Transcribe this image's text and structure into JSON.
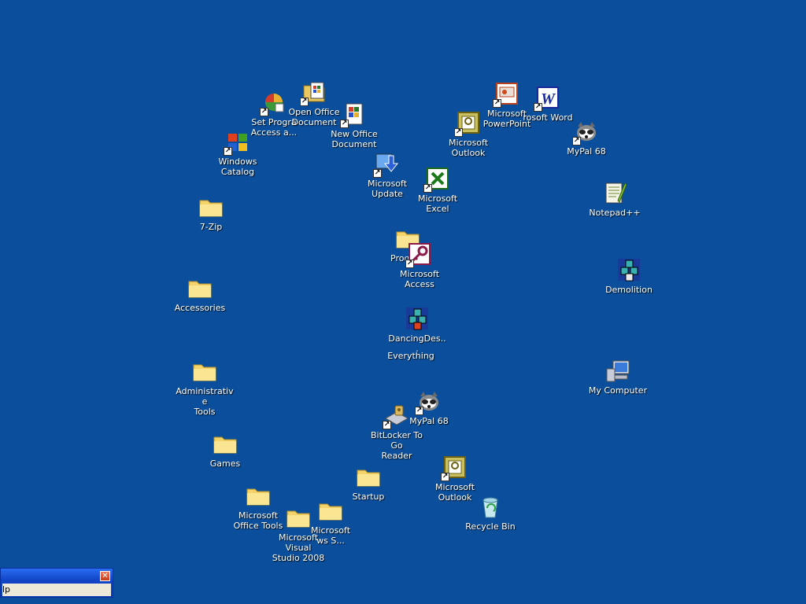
{
  "desktop": {
    "background": "#0b4f9c",
    "icons": [
      {
        "label": "Set Progra\nAccess a...",
        "icon": "set-program-access-icon",
        "shortcut": true
      },
      {
        "label": "Open Office\nDocument",
        "icon": "open-office-document-icon",
        "shortcut": true
      },
      {
        "label": "New Office\nDocument",
        "icon": "new-office-document-icon",
        "shortcut": true
      },
      {
        "label": "Windows\nCatalog",
        "icon": "windows-catalog-icon",
        "shortcut": true
      },
      {
        "label": "Microsoft\nUpdate",
        "icon": "microsoft-update-icon",
        "shortcut": true
      },
      {
        "label": "Microsoft Excel",
        "icon": "microsoft-excel-icon",
        "shortcut": true
      },
      {
        "label": "Microsoft\nOutlook",
        "icon": "microsoft-outlook-icon",
        "shortcut": true
      },
      {
        "label": "Microsoft\nPowerPoint",
        "icon": "microsoft-powerpoint-icon",
        "shortcut": true
      },
      {
        "label": "rosoft Word",
        "icon": "microsoft-word-icon",
        "shortcut": true
      },
      {
        "label": "MyPal 68",
        "icon": "mypal-icon",
        "shortcut": true
      },
      {
        "label": "Notepad++",
        "icon": "notepad-plus-plus-icon",
        "shortcut": false
      },
      {
        "label": "7-Zip",
        "icon": "folder-icon",
        "shortcut": false
      },
      {
        "label": "Prog",
        "icon": "folder-icon",
        "shortcut": false
      },
      {
        "label": "Microsoft\nAccess",
        "icon": "microsoft-access-icon",
        "shortcut": true
      },
      {
        "label": "Demolition",
        "icon": "demolition-icon",
        "shortcut": false
      },
      {
        "label": "Accessories",
        "icon": "folder-icon",
        "shortcut": false
      },
      {
        "label": "DancingDes...",
        "icon": "dancing-desktop-icon",
        "shortcut": false
      },
      {
        "label": "Everything",
        "icon": "everything-icon",
        "shortcut": false
      },
      {
        "label": "Administrative\nTools",
        "icon": "folder-icon",
        "shortcut": false
      },
      {
        "label": "My Computer",
        "icon": "my-computer-icon",
        "shortcut": false
      },
      {
        "label": "MyPal 68",
        "icon": "mypal-icon",
        "shortcut": true
      },
      {
        "label": "BitLocker To Go\nReader",
        "icon": "bitlocker-icon",
        "shortcut": true
      },
      {
        "label": "Games",
        "icon": "folder-icon",
        "shortcut": false
      },
      {
        "label": "Startup",
        "icon": "folder-icon",
        "shortcut": false
      },
      {
        "label": "Microsoft\nOutlook",
        "icon": "microsoft-outlook-icon",
        "shortcut": true
      },
      {
        "label": "Recycle Bin",
        "icon": "recycle-bin-icon",
        "shortcut": false
      },
      {
        "label": "Microsoft\nOffice Tools",
        "icon": "folder-icon",
        "shortcut": false
      },
      {
        "label": "Microsoft Visual\nStudio 2008",
        "icon": "folder-icon",
        "shortcut": false
      },
      {
        "label": "Microsoft\nws S...",
        "icon": "folder-icon",
        "shortcut": false
      }
    ]
  },
  "window": {
    "menu_text": "lp",
    "close_glyph": "✕"
  }
}
